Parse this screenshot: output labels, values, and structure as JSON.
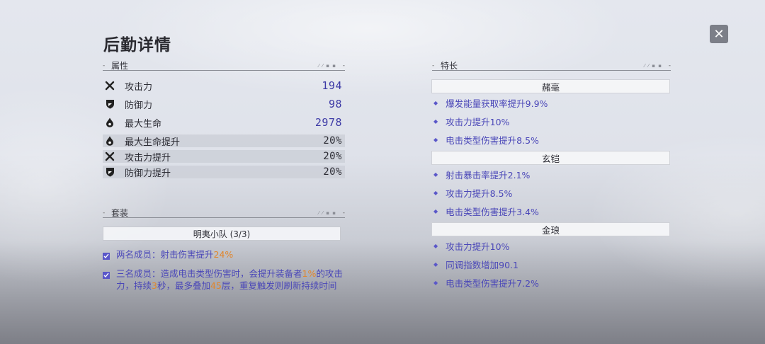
{
  "page": {
    "title": "后勤详情"
  },
  "close_label": "✕",
  "attributes_section": {
    "label": "属性"
  },
  "attributes": [
    {
      "icon": "crossed-swords-icon",
      "name": "攻击力",
      "value": "194"
    },
    {
      "icon": "shield-icon",
      "name": "防御力",
      "value": "98"
    },
    {
      "icon": "drop-icon",
      "name": "最大生命",
      "value": "2978"
    },
    {
      "icon": "drop-icon",
      "name": "最大生命提升",
      "value": "20%"
    },
    {
      "icon": "crossed-swords-icon",
      "name": "攻击力提升",
      "value": "20%"
    },
    {
      "icon": "shield-icon",
      "name": "防御力提升",
      "value": "20%"
    }
  ],
  "set_section": {
    "label": "套装"
  },
  "set": {
    "name": "明夷小队 (3/3)",
    "bonus2": {
      "pre": "两名成员：射击伤害提升",
      "hl1": "24%"
    },
    "bonus3": {
      "pre": "三名成员：造成电击类型伤害时，会提升装备者",
      "hl1": "1%",
      "mid1": "的攻击力，持续",
      "hl2": "3",
      "mid2": "秒，最多叠加",
      "hl3": "45",
      "post": "层，重复触发则刷新持续时间"
    }
  },
  "specialty_section": {
    "label": "特长"
  },
  "specialties": [
    {
      "name": "赭毫",
      "items": [
        "爆发能量获取率提升9.9%",
        "攻击力提升10%",
        "电击类型伤害提升8.5%"
      ]
    },
    {
      "name": "玄铠",
      "items": [
        "射击暴击率提升2.1%",
        "攻击力提升8.5%",
        "电击类型伤害提升3.4%"
      ]
    },
    {
      "name": "金琅",
      "items": [
        "攻击力提升10%",
        "同调指数增加90.1",
        "电击类型伤害提升7.2%"
      ]
    }
  ],
  "colors": {
    "accent": "#4a47b8",
    "highlight": "#e0862d",
    "value": "#3d3aa6"
  }
}
